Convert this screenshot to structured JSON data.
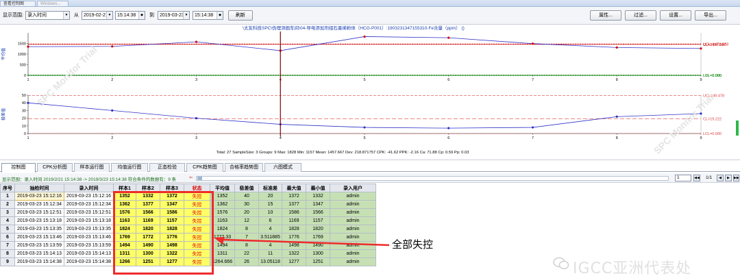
{
  "window": {
    "title": "查看控制图",
    "second_tab": "Windows..."
  },
  "toolbar": {
    "range_label": "显示范围:",
    "range_value": "录入时间",
    "from_label": "从",
    "from_date": "2019-02-21",
    "from_time": "15:14:38",
    "to_label": "到",
    "to_date": "2019-03-23",
    "to_time": "15:14:38",
    "refresh": "刷新",
    "properties": "属性...",
    "filter": "过滤...",
    "settings": "设置...",
    "export": "导出..."
  },
  "chart_data": [
    {
      "type": "line",
      "title": "\\太友科技SPC\\伪理测画车间\\04-导电添加剂组石墨烯粉体（HCG-P001）:1903231347155310-Fe含量（ppm）   ()",
      "ylabel": "平均值",
      "x": [
        1,
        2,
        3,
        4,
        5,
        6,
        7,
        8,
        9
      ],
      "values": [
        1352,
        1362,
        1576,
        1163,
        1824,
        1769,
        1494,
        1311,
        1264.666
      ],
      "ylim": [
        0,
        2000
      ],
      "yticks": [
        0,
        500,
        1000,
        1500
      ],
      "UCL_label": "UCL=1472.833",
      "CL_label": "CL=1457.667",
      "LSL_label": "LSL=0.000",
      "LCL_label": "LCL=0.000"
    },
    {
      "type": "line",
      "ylabel": "极差值",
      "x": [
        1,
        2,
        3,
        4,
        5,
        6,
        7,
        8,
        9
      ],
      "values": [
        40,
        30,
        20,
        12,
        8,
        7,
        8,
        22,
        26
      ],
      "ylim": [
        0,
        50
      ],
      "yticks": [
        0,
        10,
        20,
        30,
        40,
        50
      ],
      "UCL_label": "UCL=49.478",
      "CL_label": "CL=19.222",
      "LCL_label": "LCL=0.000",
      "stats": "Total: 27   SampleSize: 3   Groups: 9   Max: 1828   Min: 1157   Mean: 1457.667   Dev: 218.871757   CPK: -41.62   PPK: -2.16   Ca: 71.88   Cp: 0.59   Pp: 0.03"
    }
  ],
  "chart_watermark": "SPC Monitor Trial",
  "tabs": [
    "控制图",
    "CPK分析图",
    "样本运行图",
    "均值运行图",
    "正态检验",
    "CPK趋势图",
    "合格率趋势图",
    "六图模式"
  ],
  "infobar": {
    "text": "显示范围：录入时间  2019/2/21 15:14:38 -> 2019/3/23 15:14:38  符合条件的数据有：9 条",
    "page": "1",
    "total": "1/1"
  },
  "table": {
    "headers": [
      "序号",
      "抽检时间",
      "录入时间",
      "样本1",
      "样本2",
      "样本3",
      "状态",
      "平均值",
      "极差值",
      "标准差",
      "最大值",
      "最小值",
      "录入用户"
    ],
    "rows": [
      [
        "1",
        "2019-03-23 15:12:16",
        "2019-03-23 15:12:16",
        "1352",
        "1332",
        "1372",
        "失控",
        "1352",
        "40",
        "20",
        "1372",
        "1332",
        "admin"
      ],
      [
        "2",
        "2019-03-23 15:12:34",
        "2019-03-23 15:12:34",
        "1362",
        "1377",
        "1347",
        "失控",
        "1362",
        "30",
        "15",
        "1377",
        "1347",
        "admin"
      ],
      [
        "3",
        "2019-03-23 15:12:51",
        "2019-03-23 15:12:51",
        "1576",
        "1566",
        "1586",
        "失控",
        "1576",
        "20",
        "10",
        "1586",
        "1566",
        "admin"
      ],
      [
        "4",
        "2019-03-23 15:13:18",
        "2019-03-23 15:13:18",
        "1163",
        "1169",
        "1157",
        "失控",
        "1163",
        "12",
        "6",
        "1169",
        "1157",
        "admin"
      ],
      [
        "5",
        "2019-03-23 15:13:35",
        "2019-03-23 15:13:35",
        "1824",
        "1820",
        "1828",
        "失控",
        "1824",
        "8",
        "4",
        "1828",
        "1820",
        "admin"
      ],
      [
        "6",
        "2019-03-23 15:13:46",
        "2019-03-23 15:13:46",
        "1769",
        "1772",
        "1776",
        "失控",
        "1772.33",
        "7",
        "3.511885",
        "1776",
        "1769",
        "admin"
      ],
      [
        "7",
        "2019-03-23 15:13:59",
        "2019-03-23 15:13:59",
        "1494",
        "1490",
        "1498",
        "失控",
        "1494",
        "8",
        "4",
        "1498",
        "1490",
        "admin"
      ],
      [
        "8",
        "2019-03-23 15:14:13",
        "2019-03-23 15:14:13",
        "1311",
        "1300",
        "1322",
        "失控",
        "1311",
        "22",
        "11",
        "1322",
        "1300",
        "admin"
      ],
      [
        "9",
        "2019-03-23 15:14:38",
        "2019-03-23 15:14:38",
        "1266",
        "1251",
        "1277",
        "失控",
        "1264.666",
        "26",
        "13.05118",
        "1277",
        "1251",
        "admin"
      ]
    ]
  },
  "annotation": {
    "callout": "全部失控",
    "color": "#ee2b2b"
  },
  "watermark": "IGCC亚洲代表处"
}
